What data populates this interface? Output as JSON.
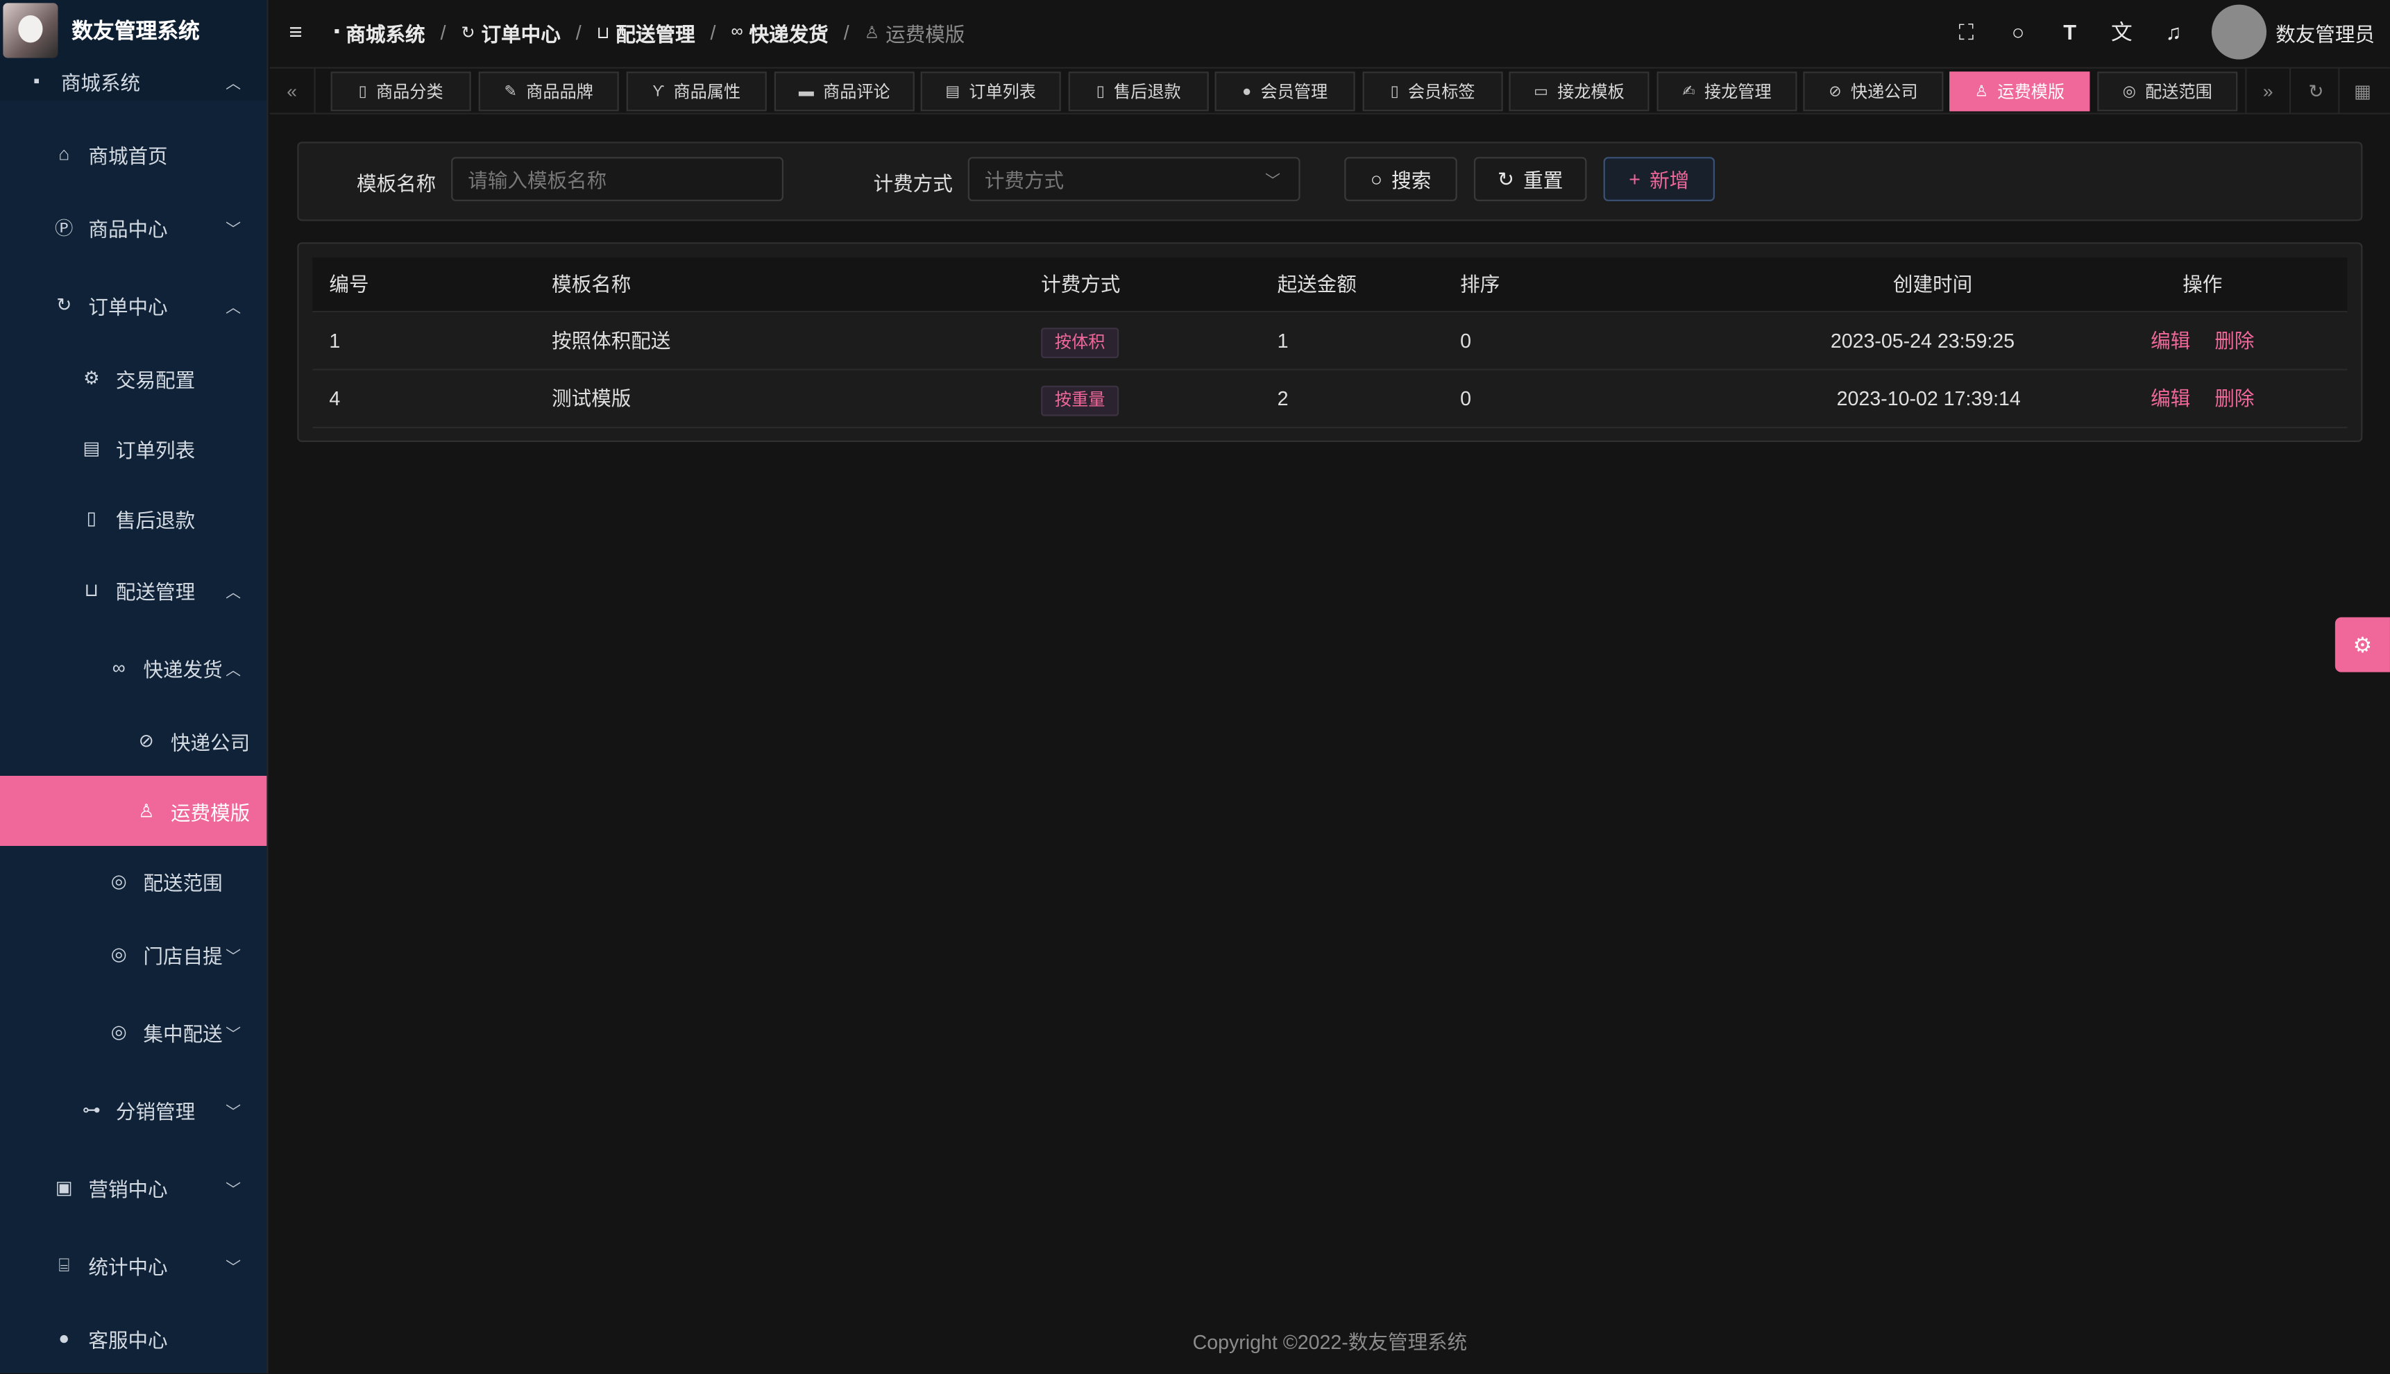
{
  "app": {
    "title": "数友管理系统"
  },
  "sidebar": {
    "items": [
      {
        "label": "商城系统"
      },
      {
        "label": "商城首页"
      },
      {
        "label": "商品中心"
      },
      {
        "label": "订单中心"
      },
      {
        "label": "交易配置"
      },
      {
        "label": "订单列表"
      },
      {
        "label": "售后退款"
      },
      {
        "label": "配送管理"
      },
      {
        "label": "快递发货"
      },
      {
        "label": "快递公司"
      },
      {
        "label": "运费模版"
      },
      {
        "label": "配送范围"
      },
      {
        "label": "门店自提"
      },
      {
        "label": "集中配送"
      },
      {
        "label": "分销管理"
      },
      {
        "label": "营销中心"
      },
      {
        "label": "统计中心"
      },
      {
        "label": "客服中心"
      }
    ]
  },
  "breadcrumb": [
    {
      "label": "商城系统"
    },
    {
      "label": "订单中心"
    },
    {
      "label": "配送管理"
    },
    {
      "label": "快递发货"
    },
    {
      "label": "运费模版"
    }
  ],
  "header": {
    "username": "数友管理员"
  },
  "tabs": [
    {
      "label": "商品分类"
    },
    {
      "label": "商品品牌"
    },
    {
      "label": "商品属性"
    },
    {
      "label": "商品评论"
    },
    {
      "label": "订单列表"
    },
    {
      "label": "售后退款"
    },
    {
      "label": "会员管理"
    },
    {
      "label": "会员标签"
    },
    {
      "label": "接龙模板"
    },
    {
      "label": "接龙管理"
    },
    {
      "label": "快递公司"
    },
    {
      "label": "运费模版"
    },
    {
      "label": "配送范围"
    }
  ],
  "search": {
    "name_label": "模板名称",
    "name_placeholder": "请输入模板名称",
    "method_label": "计费方式",
    "method_placeholder": "计费方式",
    "search_btn": "搜索",
    "reset_btn": "重置",
    "add_btn": "新增"
  },
  "table": {
    "columns": [
      "编号",
      "模板名称",
      "计费方式",
      "起送金额",
      "排序",
      "创建时间",
      "操作"
    ],
    "rows": [
      {
        "id": "1",
        "name": "按照体积配送",
        "method": "按体积",
        "min": "1",
        "sort": "0",
        "created": "2023-05-24 23:59:25",
        "edit": "编辑",
        "delete": "删除"
      },
      {
        "id": "4",
        "name": "测试模版",
        "method": "按重量",
        "min": "2",
        "sort": "0",
        "created": "2023-10-02 17:39:14",
        "edit": "编辑",
        "delete": "删除"
      }
    ]
  },
  "footer": {
    "text": "Copyright ©2022-数友管理系统"
  },
  "colors": {
    "accent": "#f0679a",
    "sidebar_bg": "#0f2237",
    "page_bg": "#141414"
  }
}
